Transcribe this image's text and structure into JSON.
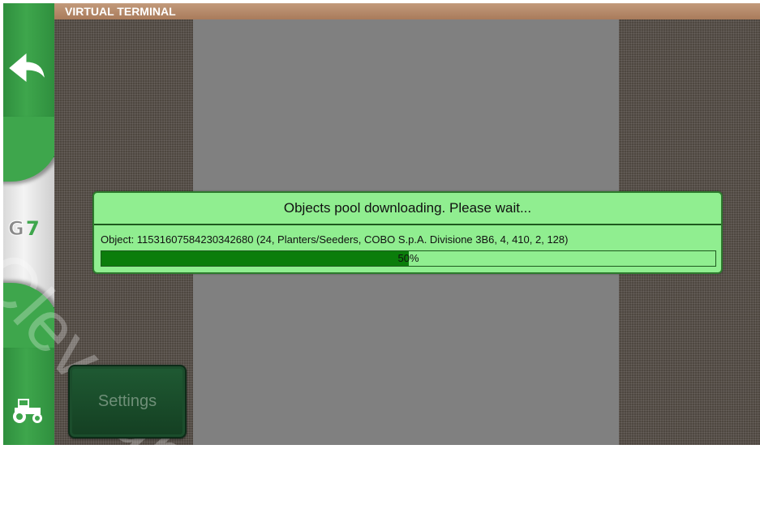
{
  "window": {
    "title": "VIRTUAL TERMINAL"
  },
  "sidebar": {
    "back_icon": "back-arrow-icon",
    "logo_text": "G7",
    "bottom_icon": "tractor-icon"
  },
  "dialog": {
    "title": "Objects pool downloading. Please wait...",
    "object_line": "Object: 11531607584230342680 (24, Planters/Seeders, COBO S.p.A. Divisione 3B6, 4, 410, 2, 128)",
    "progress_percent": 50,
    "progress_label": "50%"
  },
  "settings_button": {
    "label": "Settings"
  },
  "watermark": {
    "text": "Cleveland"
  },
  "colors": {
    "sidebar_green": "#3ea64c",
    "dialog_bg": "#90ee90",
    "progress_fill": "#0b7d0b",
    "titlebar": "#b88a69",
    "mask_grey": "#808080"
  }
}
